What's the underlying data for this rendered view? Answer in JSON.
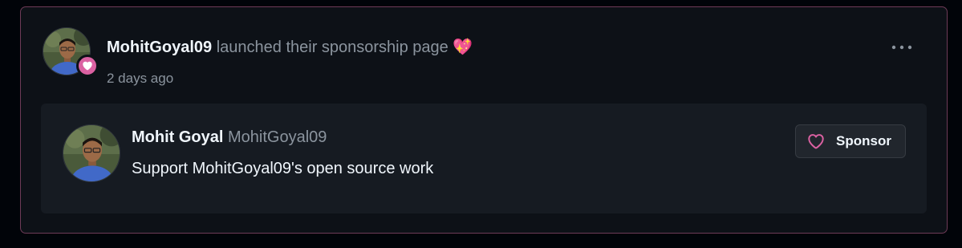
{
  "event": {
    "actor": "MohitGoyal09",
    "action_text": "launched their sponsorship page",
    "emoji": "💖",
    "timestamp": "2 days ago",
    "more_icon": "kebab-horizontal-icon"
  },
  "sponsor_card": {
    "full_name": "Mohit Goyal",
    "login": "MohitGoyal09",
    "description": "Support MohitGoyal09's open source work",
    "button_label": "Sponsor",
    "button_icon": "heart-outline-icon"
  },
  "colors": {
    "sponsor_pink": "#db61a2",
    "card_border": "#6e3b57",
    "background": "#0d1117",
    "inner_background": "#161b22",
    "muted_text": "#8b949e",
    "primary_text": "#f0f6fc"
  }
}
